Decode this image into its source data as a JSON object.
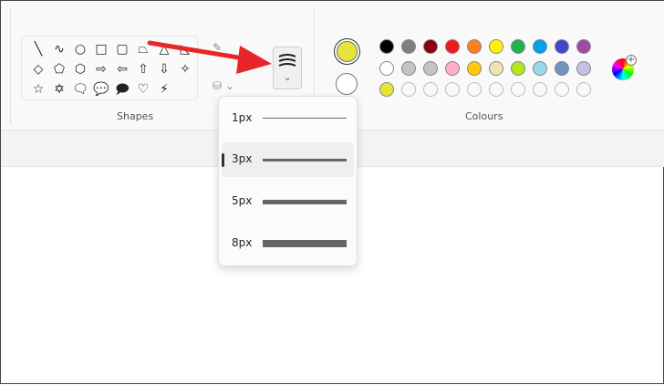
{
  "shapes": {
    "label": "Shapes",
    "items": [
      "╲",
      "∿",
      "○",
      "□",
      "▢",
      "⏢",
      "△",
      "◺",
      "◇",
      "⬠",
      "⬡",
      "⇨",
      "⇦",
      "⇧",
      "⇩",
      "✧",
      "☆",
      "✡",
      "🗨",
      "💬",
      "🗩",
      "♡",
      "⚡"
    ]
  },
  "colours": {
    "label": "Colours",
    "primary": "#e6e33a",
    "secondary": "#ffffff",
    "rows": [
      [
        "#000000",
        "#7f7f7f",
        "#880015",
        "#ed1c24",
        "#ff7f27",
        "#fff200",
        "#22b14c",
        "#00a2e8",
        "#3f48cc",
        "#a349a4"
      ],
      [
        "#ffffff",
        "#c3c3c3",
        "#c3c3c3",
        "#ffaec9",
        "#ffc90e",
        "#efe4b0",
        "#b5e61d",
        "#99d9ea",
        "#7092be",
        "#c8bfe7"
      ],
      [
        "#e6e33a",
        "",
        "",
        "",
        "",
        "",
        "",
        "",
        "",
        ""
      ]
    ]
  },
  "brush_size": {
    "options": [
      {
        "label": "1px"
      },
      {
        "label": "3px"
      },
      {
        "label": "5px"
      },
      {
        "label": "8px"
      }
    ],
    "selected": "3px"
  },
  "annotation_color": "#e8262a"
}
